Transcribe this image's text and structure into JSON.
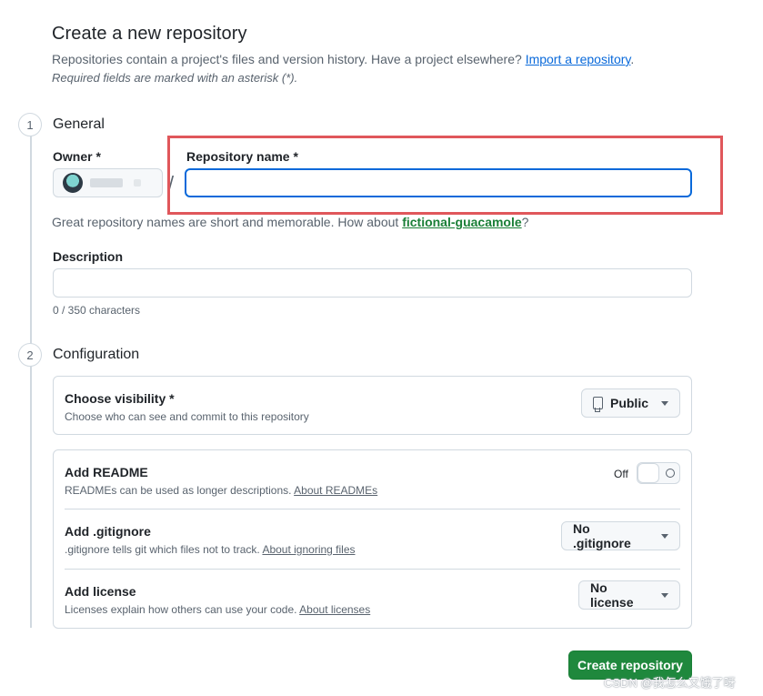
{
  "header": {
    "title": "Create a new repository",
    "intro_text": "Repositories contain a project's files and version history. Have a project elsewhere? ",
    "import_link": "Import a repository",
    "intro_end": ".",
    "required_note": "Required fields are marked with an asterisk (*)."
  },
  "general": {
    "step": "1",
    "title": "General",
    "owner_label": "Owner *",
    "slash": "/",
    "repo_name_label": "Repository name *",
    "repo_name_value": "",
    "hint_text": "Great repository names are short and memorable. How about ",
    "hint_suggestion": "fictional-guacamole",
    "hint_end": "?",
    "description_label": "Description",
    "description_value": "",
    "char_count": "0 / 350 characters"
  },
  "configuration": {
    "step": "2",
    "title": "Configuration",
    "visibility": {
      "title": "Choose visibility *",
      "desc": "Choose who can see and commit to this repository",
      "value": "Public"
    },
    "readme": {
      "title": "Add README",
      "desc": "READMEs can be used as longer descriptions. ",
      "link": "About READMEs",
      "toggle_label": "Off"
    },
    "gitignore": {
      "title": "Add .gitignore",
      "desc": ".gitignore tells git which files not to track. ",
      "link": "About ignoring files",
      "value": "No .gitignore"
    },
    "license": {
      "title": "Add license",
      "desc": "Licenses explain how others can use your code. ",
      "link": "About licenses",
      "value": "No license"
    }
  },
  "actions": {
    "create_label": "Create repository"
  },
  "watermark": "CSDN @我怎么又饿了呀",
  "colors": {
    "accent": "#0969da",
    "primary_button": "#1f883d",
    "highlight_box": "#e0575b",
    "suggestion": "#1a7f37"
  }
}
